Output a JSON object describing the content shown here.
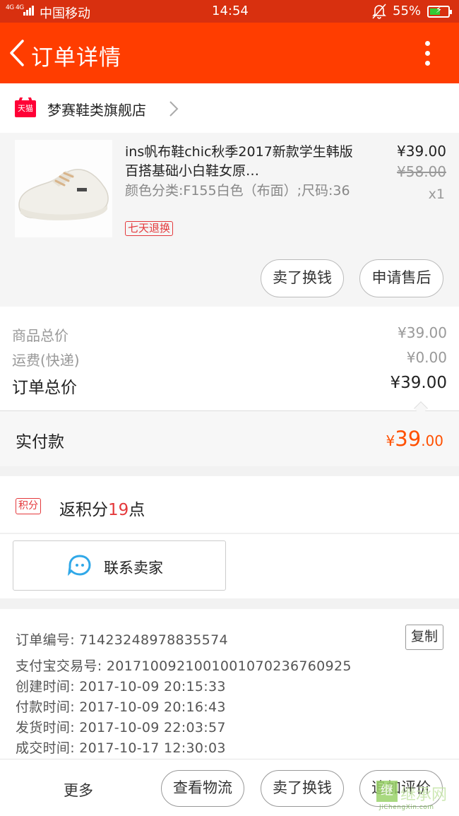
{
  "status_bar": {
    "network": "4G 4G",
    "carrier": "中国移动",
    "time": "14:54",
    "battery": "55%"
  },
  "header": {
    "title": "订单详情"
  },
  "store": {
    "name": "梦赛鞋类旗舰店",
    "badge": "天猫"
  },
  "product": {
    "title": "ins帆布鞋chic秋季2017新款学生韩版百搭基础小白鞋女原…",
    "sku": "颜色分类:F155白色（布面）;尺码:36",
    "tag": "七天退换",
    "price": "¥39.00",
    "original_price": "¥58.00",
    "quantity": "x1",
    "buttons": [
      "卖了换钱",
      "申请售后"
    ]
  },
  "totals": {
    "goods_label": "商品总价",
    "goods_value": "¥39.00",
    "shipping_label": "运费(快递)",
    "shipping_value": "¥0.00",
    "order_label": "订单总价",
    "order_value": "¥39.00"
  },
  "paid": {
    "label": "实付款",
    "currency": "¥",
    "integer": "39",
    "decimal": ".00"
  },
  "points": {
    "badge": "积分",
    "prefix": "返积分",
    "value": "19",
    "suffix": "点"
  },
  "contact": {
    "label": "联系卖家"
  },
  "order_info": {
    "order_no": "订单编号: 714232489788355​74",
    "alipay_no": "支付宝交易号: 2017100921001001070236760925",
    "created": "创建时间: 2017-10-09 20:15:33",
    "paid": "付款时间: 2017-10-09 20:16:43",
    "shipped": "发货时间: 2017-10-09 22:03:57",
    "closed": "成交时间: 2017-10-17 12:30:03",
    "copy_label": "复制"
  },
  "bottom_bar": {
    "more": "更多",
    "logistics": "查看物流",
    "resell": "卖了换钱",
    "review": "追加评价"
  },
  "watermark": {
    "text": "继承网",
    "url": "JiChengXin.com"
  },
  "colors": {
    "header": "#ff3d00",
    "accent": "#ff5000",
    "tag_red": "#e4393c"
  }
}
